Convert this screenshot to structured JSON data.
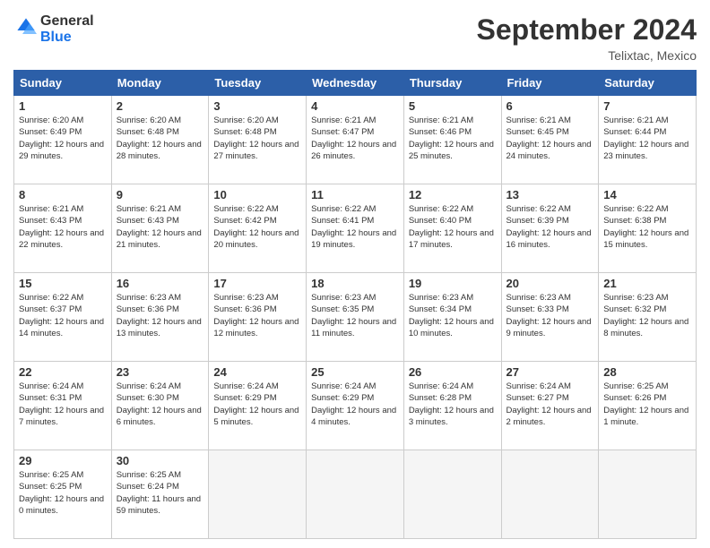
{
  "logo": {
    "line1": "General",
    "line2": "Blue"
  },
  "title": "September 2024",
  "location": "Telixtac, Mexico",
  "days_header": [
    "Sunday",
    "Monday",
    "Tuesday",
    "Wednesday",
    "Thursday",
    "Friday",
    "Saturday"
  ],
  "weeks": [
    [
      {
        "day": "1",
        "sunrise": "6:20 AM",
        "sunset": "6:49 PM",
        "daylight": "12 hours and 29 minutes."
      },
      {
        "day": "2",
        "sunrise": "6:20 AM",
        "sunset": "6:48 PM",
        "daylight": "12 hours and 28 minutes."
      },
      {
        "day": "3",
        "sunrise": "6:20 AM",
        "sunset": "6:48 PM",
        "daylight": "12 hours and 27 minutes."
      },
      {
        "day": "4",
        "sunrise": "6:21 AM",
        "sunset": "6:47 PM",
        "daylight": "12 hours and 26 minutes."
      },
      {
        "day": "5",
        "sunrise": "6:21 AM",
        "sunset": "6:46 PM",
        "daylight": "12 hours and 25 minutes."
      },
      {
        "day": "6",
        "sunrise": "6:21 AM",
        "sunset": "6:45 PM",
        "daylight": "12 hours and 24 minutes."
      },
      {
        "day": "7",
        "sunrise": "6:21 AM",
        "sunset": "6:44 PM",
        "daylight": "12 hours and 23 minutes."
      }
    ],
    [
      {
        "day": "8",
        "sunrise": "6:21 AM",
        "sunset": "6:43 PM",
        "daylight": "12 hours and 22 minutes."
      },
      {
        "day": "9",
        "sunrise": "6:21 AM",
        "sunset": "6:43 PM",
        "daylight": "12 hours and 21 minutes."
      },
      {
        "day": "10",
        "sunrise": "6:22 AM",
        "sunset": "6:42 PM",
        "daylight": "12 hours and 20 minutes."
      },
      {
        "day": "11",
        "sunrise": "6:22 AM",
        "sunset": "6:41 PM",
        "daylight": "12 hours and 19 minutes."
      },
      {
        "day": "12",
        "sunrise": "6:22 AM",
        "sunset": "6:40 PM",
        "daylight": "12 hours and 17 minutes."
      },
      {
        "day": "13",
        "sunrise": "6:22 AM",
        "sunset": "6:39 PM",
        "daylight": "12 hours and 16 minutes."
      },
      {
        "day": "14",
        "sunrise": "6:22 AM",
        "sunset": "6:38 PM",
        "daylight": "12 hours and 15 minutes."
      }
    ],
    [
      {
        "day": "15",
        "sunrise": "6:22 AM",
        "sunset": "6:37 PM",
        "daylight": "12 hours and 14 minutes."
      },
      {
        "day": "16",
        "sunrise": "6:23 AM",
        "sunset": "6:36 PM",
        "daylight": "12 hours and 13 minutes."
      },
      {
        "day": "17",
        "sunrise": "6:23 AM",
        "sunset": "6:36 PM",
        "daylight": "12 hours and 12 minutes."
      },
      {
        "day": "18",
        "sunrise": "6:23 AM",
        "sunset": "6:35 PM",
        "daylight": "12 hours and 11 minutes."
      },
      {
        "day": "19",
        "sunrise": "6:23 AM",
        "sunset": "6:34 PM",
        "daylight": "12 hours and 10 minutes."
      },
      {
        "day": "20",
        "sunrise": "6:23 AM",
        "sunset": "6:33 PM",
        "daylight": "12 hours and 9 minutes."
      },
      {
        "day": "21",
        "sunrise": "6:23 AM",
        "sunset": "6:32 PM",
        "daylight": "12 hours and 8 minutes."
      }
    ],
    [
      {
        "day": "22",
        "sunrise": "6:24 AM",
        "sunset": "6:31 PM",
        "daylight": "12 hours and 7 minutes."
      },
      {
        "day": "23",
        "sunrise": "6:24 AM",
        "sunset": "6:30 PM",
        "daylight": "12 hours and 6 minutes."
      },
      {
        "day": "24",
        "sunrise": "6:24 AM",
        "sunset": "6:29 PM",
        "daylight": "12 hours and 5 minutes."
      },
      {
        "day": "25",
        "sunrise": "6:24 AM",
        "sunset": "6:29 PM",
        "daylight": "12 hours and 4 minutes."
      },
      {
        "day": "26",
        "sunrise": "6:24 AM",
        "sunset": "6:28 PM",
        "daylight": "12 hours and 3 minutes."
      },
      {
        "day": "27",
        "sunrise": "6:24 AM",
        "sunset": "6:27 PM",
        "daylight": "12 hours and 2 minutes."
      },
      {
        "day": "28",
        "sunrise": "6:25 AM",
        "sunset": "6:26 PM",
        "daylight": "12 hours and 1 minute."
      }
    ],
    [
      {
        "day": "29",
        "sunrise": "6:25 AM",
        "sunset": "6:25 PM",
        "daylight": "12 hours and 0 minutes."
      },
      {
        "day": "30",
        "sunrise": "6:25 AM",
        "sunset": "6:24 PM",
        "daylight": "11 hours and 59 minutes."
      },
      null,
      null,
      null,
      null,
      null
    ]
  ]
}
